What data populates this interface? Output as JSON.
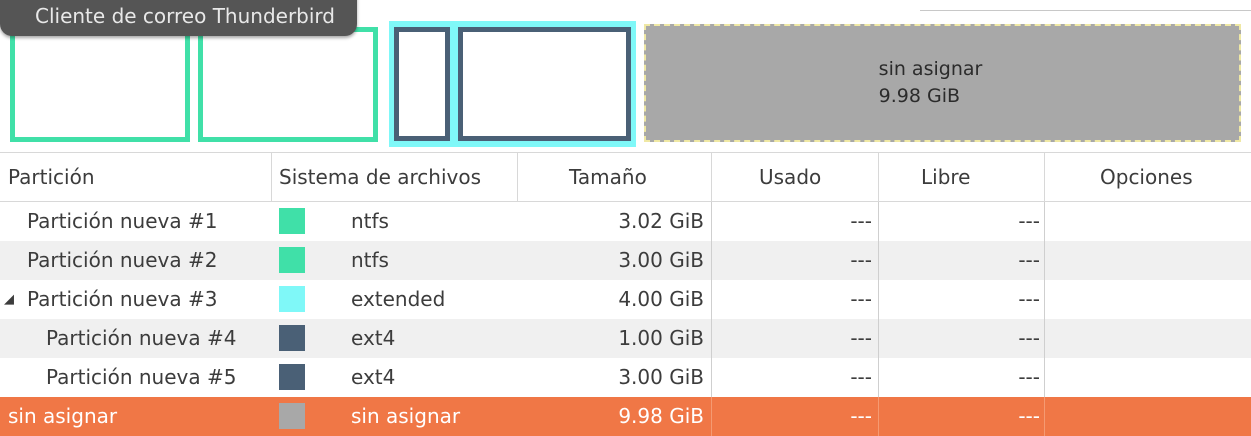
{
  "tooltip": "Cliente de correo Thunderbird",
  "map": {
    "unallocated_label": "sin asignar",
    "unallocated_size": "9.98 GiB"
  },
  "columns": {
    "partition": "Partición",
    "filesystem": "Sistema de archivos",
    "size": "Tamaño",
    "used": "Usado",
    "free": "Libre",
    "options": "Opciones"
  },
  "rows": [
    {
      "name": "Partición nueva #1",
      "color": "#40e0a8",
      "fs": "ntfs",
      "size": "3.02 GiB",
      "used": "---",
      "free": "---"
    },
    {
      "name": "Partición nueva #2",
      "color": "#40e0a8",
      "fs": "ntfs",
      "size": "3.00 GiB",
      "used": "---",
      "free": "---"
    },
    {
      "name": "Partición nueva #3",
      "color": "#7ff8f8",
      "fs": "extended",
      "size": "4.00 GiB",
      "used": "---",
      "free": "---"
    },
    {
      "name": "Partición nueva #4",
      "color": "#4a6076",
      "fs": "ext4",
      "size": "1.00 GiB",
      "used": "---",
      "free": "---"
    },
    {
      "name": "Partición nueva #5",
      "color": "#4a6076",
      "fs": "ext4",
      "size": "3.00 GiB",
      "used": "---",
      "free": "---"
    },
    {
      "name": "sin asignar",
      "color": "#a8a8a8",
      "fs": "sin asignar",
      "size": "9.98 GiB",
      "used": "---",
      "free": "---"
    }
  ],
  "selection_color": "#f07746"
}
